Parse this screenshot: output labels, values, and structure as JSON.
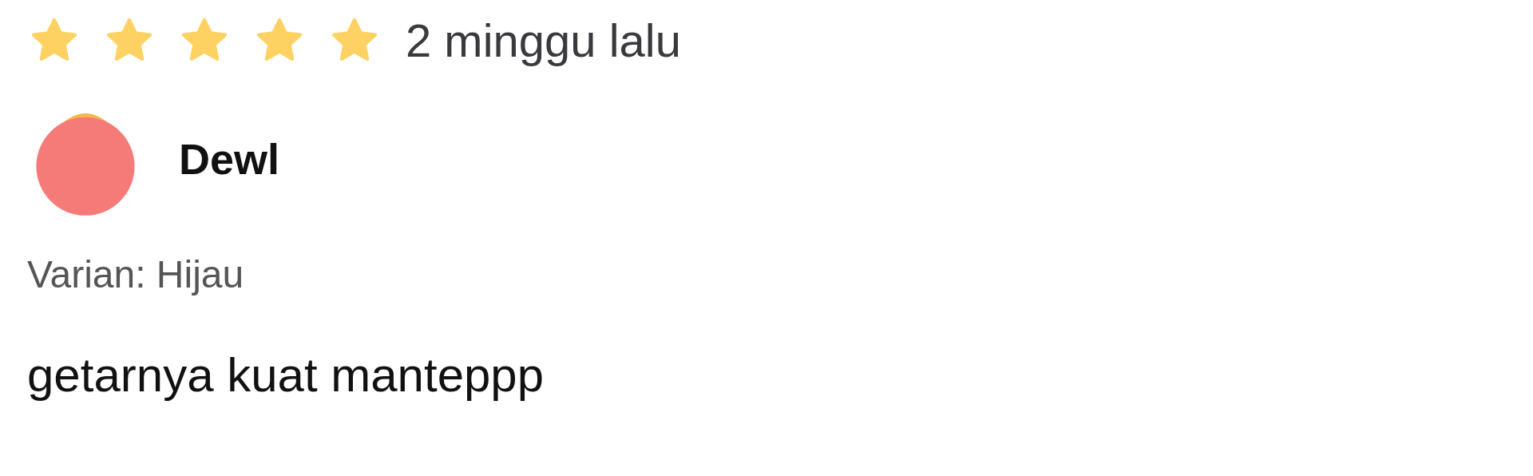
{
  "review": {
    "stars": 5,
    "time": "2 minggu lalu",
    "user": {
      "name": "Dewl"
    },
    "variant": "Varian: Hijau",
    "text": "getarnya kuat manteppp"
  }
}
